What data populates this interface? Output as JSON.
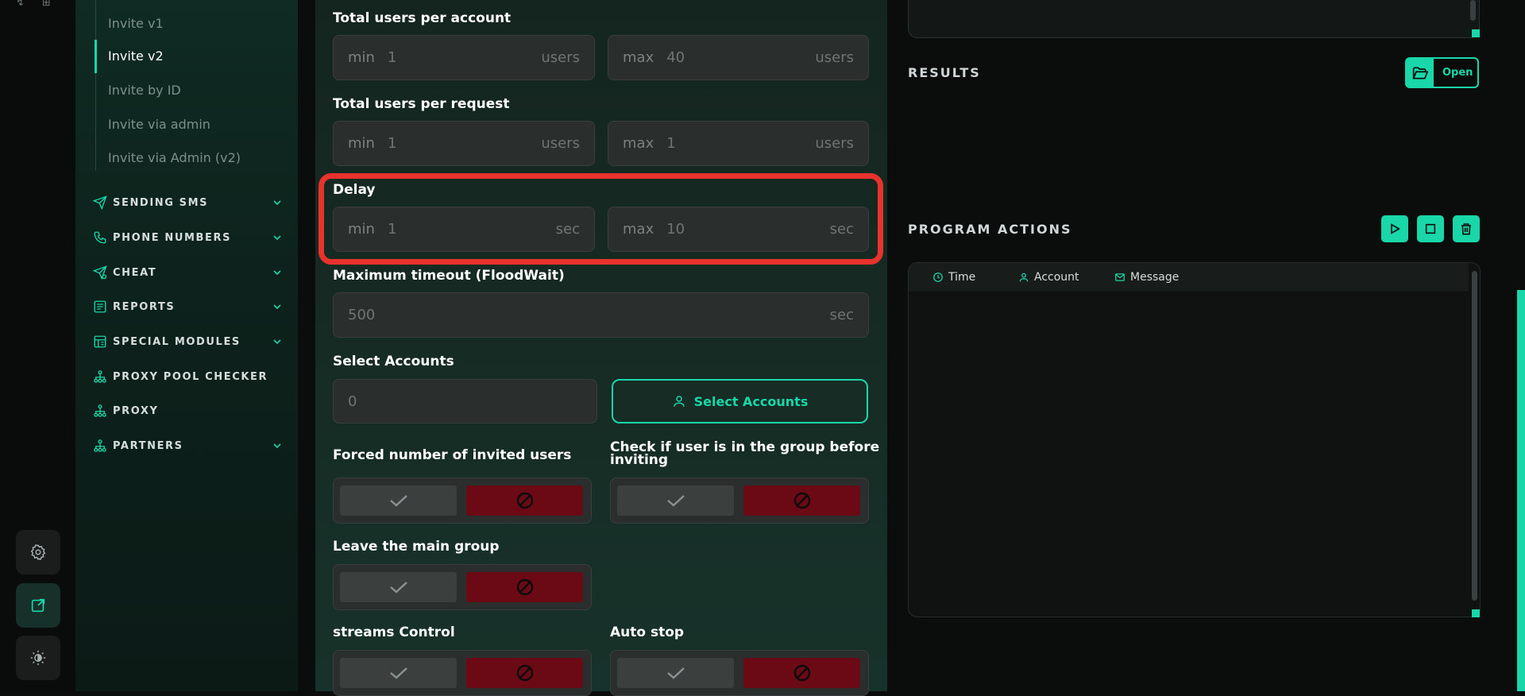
{
  "sidebar": {
    "sub_items": [
      "Invite v1",
      "Invite v2",
      "Invite by ID",
      "Invite via admin",
      "Invite via Admin (v2)"
    ],
    "nav": [
      {
        "label": "SENDING SMS",
        "icon": "send-icon",
        "expandable": true
      },
      {
        "label": "PHONE NUMBERS",
        "icon": "phone-icon",
        "expandable": true
      },
      {
        "label": "CHEAT",
        "icon": "cheat-icon",
        "expandable": true
      },
      {
        "label": "REPORTS",
        "icon": "report-icon",
        "expandable": true
      },
      {
        "label": "SPECIAL MODULES",
        "icon": "modules-icon",
        "expandable": true
      },
      {
        "label": "PROXY POOL CHECKER",
        "icon": "network-icon",
        "expandable": false
      },
      {
        "label": "PROXY",
        "icon": "network-icon",
        "expandable": false
      },
      {
        "label": "PARTNERS",
        "icon": "network-icon",
        "expandable": true
      }
    ]
  },
  "form": {
    "users_per_account": {
      "label": "Total users per account",
      "min_prefix": "min",
      "min": "1",
      "max_prefix": "max",
      "max": "40",
      "unit": "users"
    },
    "users_per_request": {
      "label": "Total users per request",
      "min_prefix": "min",
      "min": "1",
      "max_prefix": "max",
      "max": "1",
      "unit": "users"
    },
    "delay": {
      "label": "Delay",
      "min_prefix": "min",
      "min": "1",
      "max_prefix": "max",
      "max": "10",
      "unit": "sec"
    },
    "timeout": {
      "label": "Maximum timeout (FloodWait)",
      "value": "500",
      "unit": "sec"
    },
    "select_accounts": {
      "label": "Select Accounts",
      "value": "0",
      "button": "Select Accounts"
    },
    "forced_number": {
      "label": "Forced number of invited users"
    },
    "check_user": {
      "label_line1": "Check if user is in the group before",
      "label_line2": "inviting"
    },
    "leave_group": {
      "label": "Leave the main group"
    },
    "streams_control": {
      "label": "streams Control"
    },
    "auto_stop": {
      "label": "Auto stop"
    }
  },
  "right": {
    "results_title": "RESULTS",
    "open_label": "Open",
    "program_actions_title": "PROGRAM ACTIONS",
    "columns": [
      "Time",
      "Account",
      "Message"
    ]
  },
  "colors": {
    "accent": "#19d7a8",
    "danger": "#6b0a14",
    "highlight": "#e8322c"
  }
}
